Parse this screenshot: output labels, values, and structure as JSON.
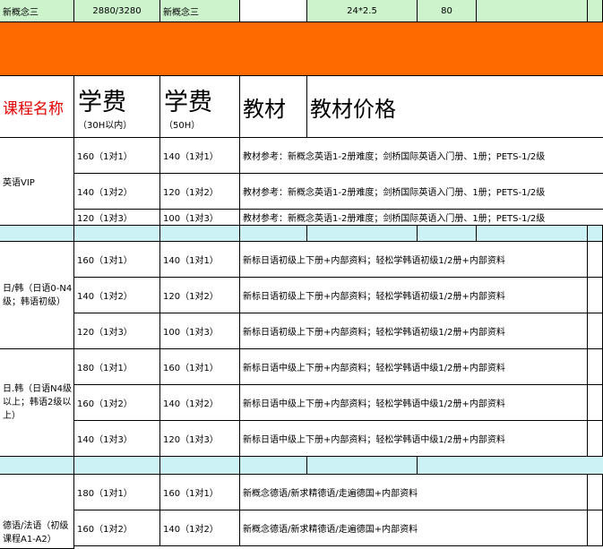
{
  "top_row": {
    "c0": "新概念三",
    "c1": "2880/3280",
    "c2": "新概念三",
    "c3": "",
    "c4": "24*2.5",
    "c5": "80"
  },
  "header": {
    "course_name": "课程名称",
    "fee1": "学费",
    "fee1_sub": "（30H以内）",
    "fee2": "学费",
    "fee2_sub": "（50H）",
    "textbook": "教材",
    "textbook_price": "教材价格"
  },
  "groups": [
    {
      "name": "英语VIP",
      "rows": [
        {
          "fee30": "160（1对1）",
          "fee50": "140（1对1）",
          "book": "教材参考：新概念英语1-2册难度；剑桥国际英语入门册、1册；PETS-1/2级"
        },
        {
          "fee30": "140（1对2）",
          "fee50": "120（1对2）",
          "book": "教材参考：新概念英语1-2册难度；剑桥国际英语入门册、1册；PETS-1/2级"
        },
        {
          "fee30": "120（1对3）",
          "fee50": "100（1对3）",
          "book": "教材参考：新概念英语1-2册难度；剑桥国际英语入门册、1册；PETS-1/2级"
        }
      ]
    },
    {
      "name": "日/韩（日语0-N4级；韩语初级）",
      "rows": [
        {
          "fee30": "160（1对1）",
          "fee50": "140（1对1）",
          "book": "新标日语初级上下册+内部资料；轻松学韩语初级1/2册+内部资料"
        },
        {
          "fee30": "140（1对2）",
          "fee50": "120（1对2）",
          "book": "新标日语初级上下册+内部资料；轻松学韩语初级1/2册+内部资料"
        },
        {
          "fee30": "120（1对3）",
          "fee50": "100（1对3）",
          "book": "新标日语初级上下册+内部资料；轻松学韩语初级1/2册+内部资料"
        }
      ]
    },
    {
      "name": "日.韩（日语N4级以上；韩语2级以上）",
      "rows": [
        {
          "fee30": "180（1对1）",
          "fee50": "160（1对1）",
          "book": "新标日语中级上下册+内部资料；轻松学韩语中级1/2册+内部资料"
        },
        {
          "fee30": "160（1对2）",
          "fee50": "140（1对2）",
          "book": "新标日语中级上下册+内部资料；轻松学韩语中级1/2册+内部资料"
        },
        {
          "fee30": "140（1对3）",
          "fee50": "120（1对3）",
          "book": "新标日语中级上下册+内部资料；轻松学韩语中级1/2册+内部资料"
        }
      ]
    },
    {
      "name": "德语/法语（初级课程A1-A2）",
      "rows": [
        {
          "fee30": "180（1对1）",
          "fee50": "160（1对1）",
          "book": "新概念德语/新求精德语/走遍德国+内部资料"
        },
        {
          "fee30": "160（1对2）",
          "fee50": "140（1对2）",
          "book": "新概念德语/新求精德语/走遍德国+内部资料"
        }
      ]
    }
  ],
  "colors": {
    "accent_orange": "#ff6a00",
    "header_red": "#e00000",
    "top_green": "#cdf3cd",
    "separator_cyan": "#ccf2f6"
  }
}
